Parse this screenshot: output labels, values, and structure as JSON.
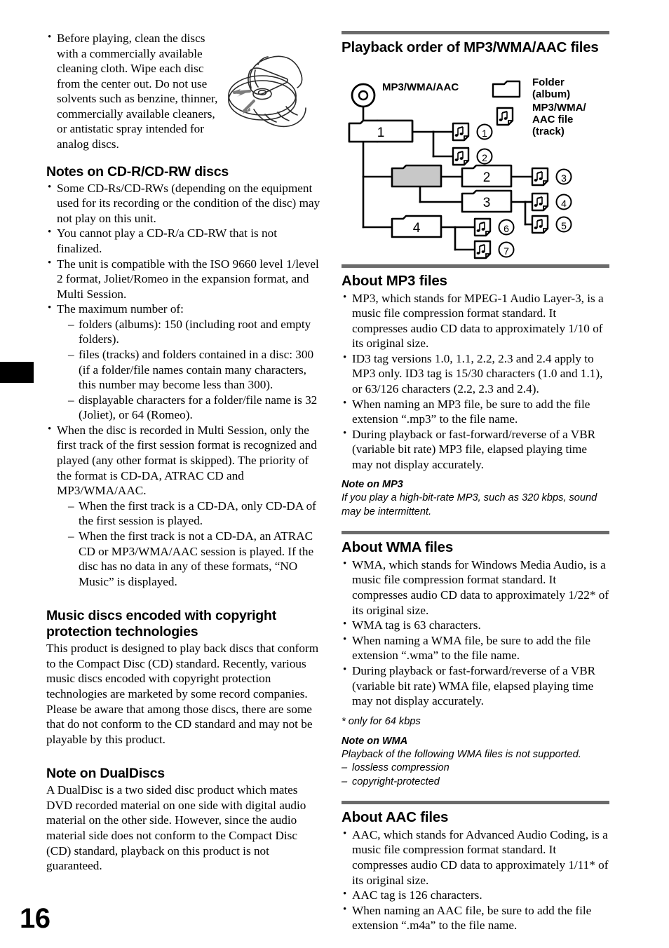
{
  "page": {
    "number": "16"
  },
  "left_column": {
    "intro_bullets": [
      "Before playing, clean the discs with a commercially available cleaning cloth. Wipe each disc from the center out. Do not use solvents such as benzine, thinner, commercially available cleaners, or antistatic spray intended for analog discs."
    ],
    "section_cdr": {
      "heading": "Notes on CD-R/CD-RW discs",
      "bullets": [
        "Some CD-Rs/CD-RWs (depending on the equipment used for its recording or the condition of the disc) may not play on this unit.",
        "You cannot play a CD-R/a CD-RW that is not finalized.",
        "The unit is compatible with the ISO 9660 level 1/level 2 format, Joliet/Romeo in the expansion format, and Multi Session."
      ],
      "max_number_intro": "The maximum number of:",
      "max_number_items": [
        "folders (albums): 150 (including root and empty folders).",
        "files (tracks) and folders contained in a disc: 300 (if a folder/file names contain many characters, this number may become less than 300).",
        "displayable characters for a folder/file name is 32 (Joliet), or 64 (Romeo)."
      ],
      "multi_session_intro": "When the disc is recorded in Multi Session, only the first track of the first session format is recognized and played (any other format is skipped). The priority of the format is CD-DA, ATRAC CD and MP3/WMA/AAC.",
      "multi_session_items": [
        "When the first track is a CD-DA, only CD-DA of the first session is played.",
        "When the first track is not a CD-DA, an ATRAC CD or MP3/WMA/AAC session is played. If the disc has no data in any of these formats, “NO Music” is displayed."
      ]
    },
    "section_copyright": {
      "heading": "Music discs encoded with copyright protection technologies",
      "body": "This product is designed to play back discs that conform to the Compact Disc (CD) standard. Recently, various music discs encoded with copyright protection technologies are marketed by some record companies. Please be aware that among those discs, there are some that do not conform to the CD standard and may not be playable by this product."
    },
    "section_dualdisc": {
      "heading": "Note on DualDiscs",
      "body": "A DualDisc is a two sided disc product which mates DVD recorded material on one side with digital audio material on the other side. However, since the audio material side does not conform to the Compact Disc (CD) standard, playback on this product is not guaranteed."
    }
  },
  "right_column": {
    "section_playback": {
      "heading": "Playback order of MP3/WMA/AAC files",
      "diagram": {
        "disc_label": "MP3/WMA/AAC",
        "legend": [
          {
            "icon": "folder-icon",
            "line1": "Folder",
            "line2": "(album)"
          },
          {
            "icon": "music-file-icon",
            "line1": "MP3/WMA/",
            "line2": "AAC file",
            "line3": "(track)"
          }
        ],
        "folders": [
          {
            "name": "1",
            "shaded": false
          },
          {
            "name": "",
            "shaded": true
          },
          {
            "name": "2",
            "shaded": false
          },
          {
            "name": "3",
            "shaded": false
          },
          {
            "name": "4",
            "shaded": false
          }
        ],
        "track_order": [
          "1",
          "2",
          "3",
          "4",
          "5",
          "6",
          "7"
        ]
      }
    },
    "section_mp3": {
      "heading": "About MP3 files",
      "bullets": [
        "MP3, which stands for MPEG-1 Audio Layer-3, is a music file compression format standard. It compresses audio CD data to approximately 1/10 of its original size.",
        "ID3 tag versions 1.0, 1.1, 2.2, 2.3 and 2.4 apply to MP3 only. ID3 tag is 15/30 characters (1.0 and 1.1), or 63/126 characters (2.2, 2.3 and 2.4).",
        "When naming an MP3 file, be sure to add the file extension “.mp3” to the file name.",
        "During playback or fast-forward/reverse of a VBR (variable bit rate) MP3 file, elapsed playing time may not display accurately."
      ],
      "note_heading": "Note on MP3",
      "note_body": "If you play a high-bit-rate MP3, such as 320 kbps, sound may be intermittent."
    },
    "section_wma": {
      "heading": "About WMA files",
      "bullets": [
        "WMA, which stands for Windows Media Audio, is a music file compression format standard. It compresses audio CD data to approximately 1/22* of its original size.",
        "WMA tag is 63 characters.",
        "When naming a WMA file, be sure to add the file extension “.wma” to the file name.",
        "During playback or fast-forward/reverse of a VBR (variable bit rate) WMA file, elapsed playing time may not display accurately."
      ],
      "footnote": "* only for 64 kbps",
      "note_heading": "Note on WMA",
      "note_body": "Playback of the following WMA files is not supported.",
      "note_items": [
        "lossless compression",
        "copyright-protected"
      ]
    },
    "section_aac": {
      "heading": "About AAC files",
      "bullets": [
        "AAC, which stands for Advanced Audio Coding, is a music file compression format standard. It compresses audio CD data to approximately 1/11* of its original size.",
        "AAC tag is 126 characters.",
        "When naming an AAC file, be sure to add the file extension “.m4a” to the file name."
      ]
    }
  },
  "colors": {
    "rule": "#6b6b6b",
    "shaded_folder": "#c8c8c8",
    "text": "#000000"
  }
}
